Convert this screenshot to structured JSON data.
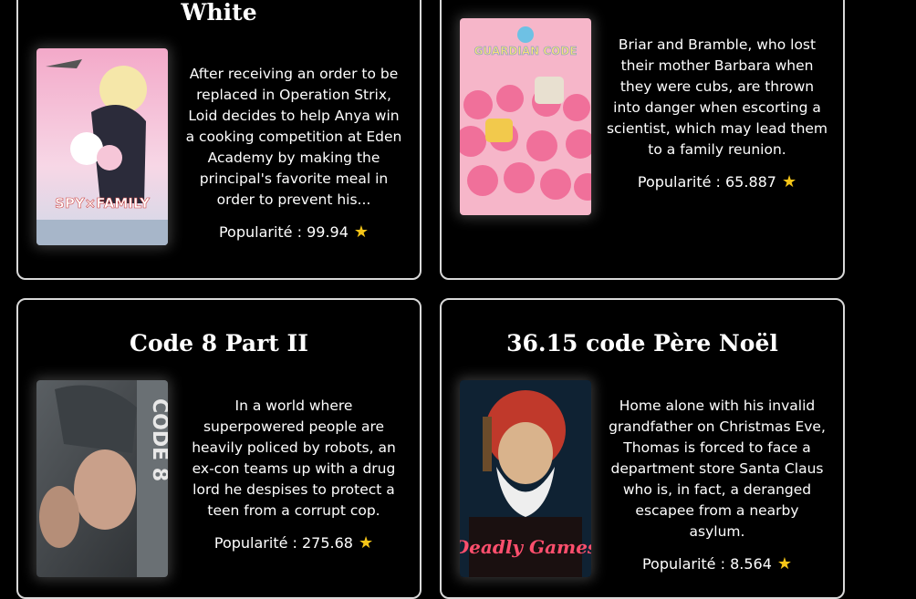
{
  "cards": [
    {
      "title": "White",
      "overview": "After receiving an order to be replaced in Operation Strix, Loid decides to help Anya win a cooking competition at Eden Academy by making the principal's favorite meal in order to prevent his...",
      "popularity_label": "Popularité : 99.94",
      "poster_text": "SPY×FAMILY",
      "poster_icon": "anime-family-poster"
    },
    {
      "title": "",
      "overview": "Briar and Bramble, who lost their mother Barbara when they were cubs, are thrown into danger when escorting a scientist, which may lead them to a family reunion.",
      "popularity_label": "Popularité : 65.887",
      "poster_text": "GUARDIAN CODE",
      "poster_icon": "pink-creatures-poster"
    },
    {
      "title": "Code 8 Part II",
      "overview": "In a world where superpowered people are heavily policed by robots, an ex-con teams up with a drug lord he despises to protect a teen from a corrupt cop.",
      "popularity_label": "Popularité : 275.68",
      "poster_text": "CODE 8",
      "poster_icon": "robot-helmet-poster"
    },
    {
      "title": "36.15 code Père Noël",
      "overview": "Home alone with his invalid grandfather on Christmas Eve, Thomas is forced to face a department store Santa Claus who is, in fact, a deranged escapee from a nearby asylum.",
      "popularity_label": "Popularité : 8.564",
      "poster_text": "Deadly Games",
      "poster_icon": "evil-santa-poster"
    }
  ],
  "star_glyph": "★",
  "colors": {
    "star": "#f5c518",
    "card_border": "#d9d9d9",
    "background": "#000000"
  }
}
